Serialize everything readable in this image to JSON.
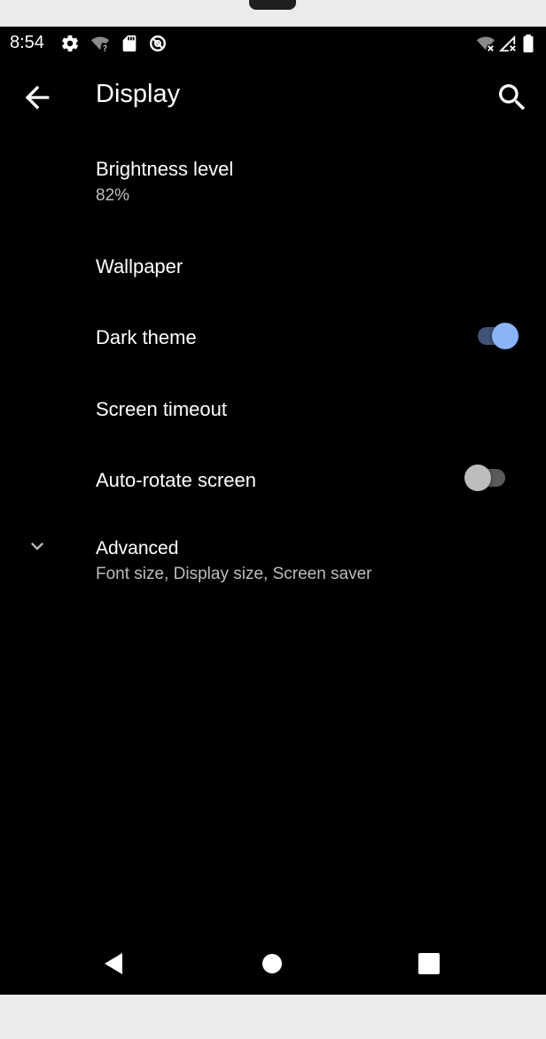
{
  "status_bar": {
    "time": "8:54",
    "left_icons": [
      "settings-gear-icon",
      "wifi-question-icon",
      "sd-card-icon",
      "data-saver-icon"
    ],
    "right_icons": [
      "wifi-off-icon",
      "cell-signal-off-icon",
      "battery-icon"
    ]
  },
  "toolbar": {
    "title": "Display",
    "back_icon": "arrow-back-icon",
    "search_icon": "search-icon"
  },
  "preferences": {
    "brightness": {
      "title": "Brightness level",
      "summary": "82%"
    },
    "wallpaper": {
      "title": "Wallpaper"
    },
    "dark_theme": {
      "title": "Dark theme",
      "enabled": true
    },
    "screen_timeout": {
      "title": "Screen timeout"
    },
    "auto_rotate": {
      "title": "Auto-rotate screen",
      "enabled": false
    },
    "advanced": {
      "title": "Advanced",
      "summary": "Font size, Display size, Screen saver",
      "icon": "chevron-down-icon"
    }
  },
  "nav_bar": {
    "back": "nav-back-icon",
    "home": "nav-home-icon",
    "recents": "nav-recents-icon"
  },
  "colors": {
    "background": "#000000",
    "text_primary": "#ffffff",
    "text_secondary": "#bdbdbd",
    "accent": "#8ab4f8",
    "accent_track": "#3f5378"
  }
}
